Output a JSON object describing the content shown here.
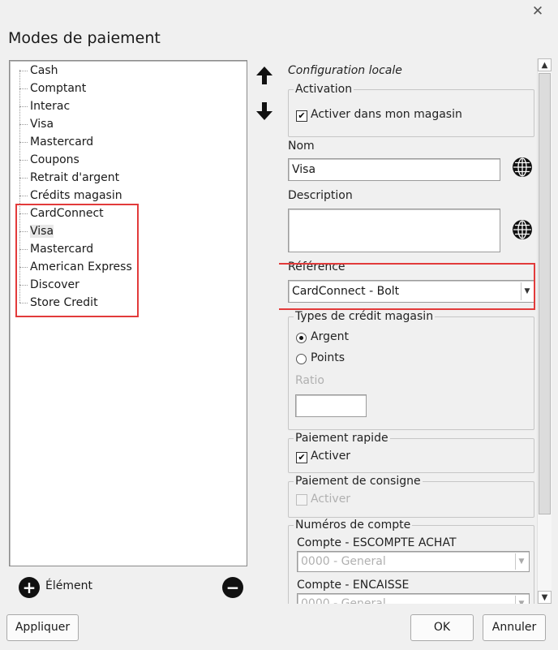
{
  "window": {
    "title": "Modes de paiement",
    "close_glyph": "✕"
  },
  "tree": {
    "items": [
      "Cash",
      "Comptant",
      "Interac",
      "Visa",
      "Mastercard",
      "Coupons",
      "Retrait d'argent",
      "Crédits magasin",
      "CardConnect",
      "Visa",
      "Mastercard",
      "American Express",
      "Discover",
      "Store Credit"
    ],
    "selected_index": 9
  },
  "left_actions": {
    "add_label": "Élément"
  },
  "config": {
    "section_title": "Configuration locale",
    "activation": {
      "group": "Activation",
      "checkbox_label": "Activer dans mon magasin",
      "checked": true
    },
    "name": {
      "label": "Nom",
      "value": "Visa"
    },
    "description": {
      "label": "Description",
      "value": ""
    },
    "reference": {
      "label": "Référence",
      "value": "CardConnect - Bolt"
    },
    "credit_types": {
      "group": "Types de crédit magasin",
      "options": [
        "Argent",
        "Points"
      ],
      "selected": "Argent",
      "ratio_label": "Ratio",
      "ratio_value": ""
    },
    "quick_payment": {
      "group": "Paiement rapide",
      "checkbox_label": "Activer",
      "checked": true
    },
    "deposit_payment": {
      "group": "Paiement de consigne",
      "checkbox_label": "Activer",
      "checked": false
    },
    "accounts": {
      "group": "Numéros de compte",
      "rows": [
        {
          "label": "Compte - ESCOMPTE ACHAT",
          "value": "0000 - General"
        },
        {
          "label": "Compte - ENCAISSE",
          "value": "0000 - General"
        }
      ]
    }
  },
  "buttons": {
    "apply": "Appliquer",
    "ok": "OK",
    "cancel": "Annuler"
  },
  "colors": {
    "highlight_border": "#e23b3b",
    "background": "#f0f0f0"
  }
}
